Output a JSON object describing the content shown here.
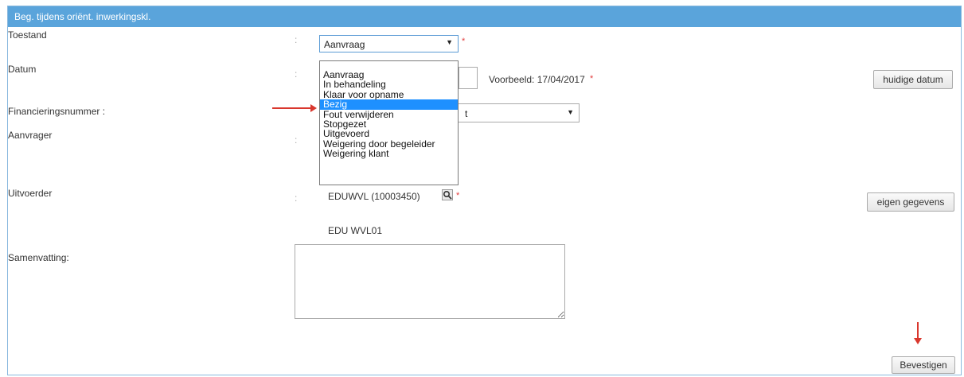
{
  "panel": {
    "title": "Beg. tijdens oriënt. inwerkingskl."
  },
  "fields": {
    "toestand": {
      "label": "Toestand",
      "value": "Aanvraag"
    },
    "datum": {
      "label": "Datum",
      "example": "Voorbeeld: 17/04/2017",
      "button": "huidige datum"
    },
    "financiering": {
      "label": "Financieringsnummer :",
      "value_partial": "t"
    },
    "aanvrager": {
      "label": "Aanvrager"
    },
    "uitvoerder": {
      "label": "Uitvoerder",
      "value": "EDUWVL (10003450)",
      "subvalue": "EDU WVL01",
      "button": "eigen gegevens"
    },
    "samenvatting": {
      "label": "Samenvatting:"
    }
  },
  "colon": ":",
  "required_mark": "*",
  "dropdown": {
    "options": [
      "Aanvraag",
      "In behandeling",
      "Klaar voor opname",
      "Bezig",
      "Fout verwijderen",
      "Stopgezet",
      "Uitgevoerd",
      "Weigering door begeleider",
      "Weigering klant"
    ],
    "highlighted": "Bezig"
  },
  "confirm_button": "Bevestigen",
  "icons": {
    "select_arrow": "▼",
    "search": "search-icon"
  },
  "colors": {
    "header": "#5aa4db",
    "highlight": "#1e90ff",
    "annotation_arrow": "#d9372d",
    "required": "#e23c3c"
  }
}
